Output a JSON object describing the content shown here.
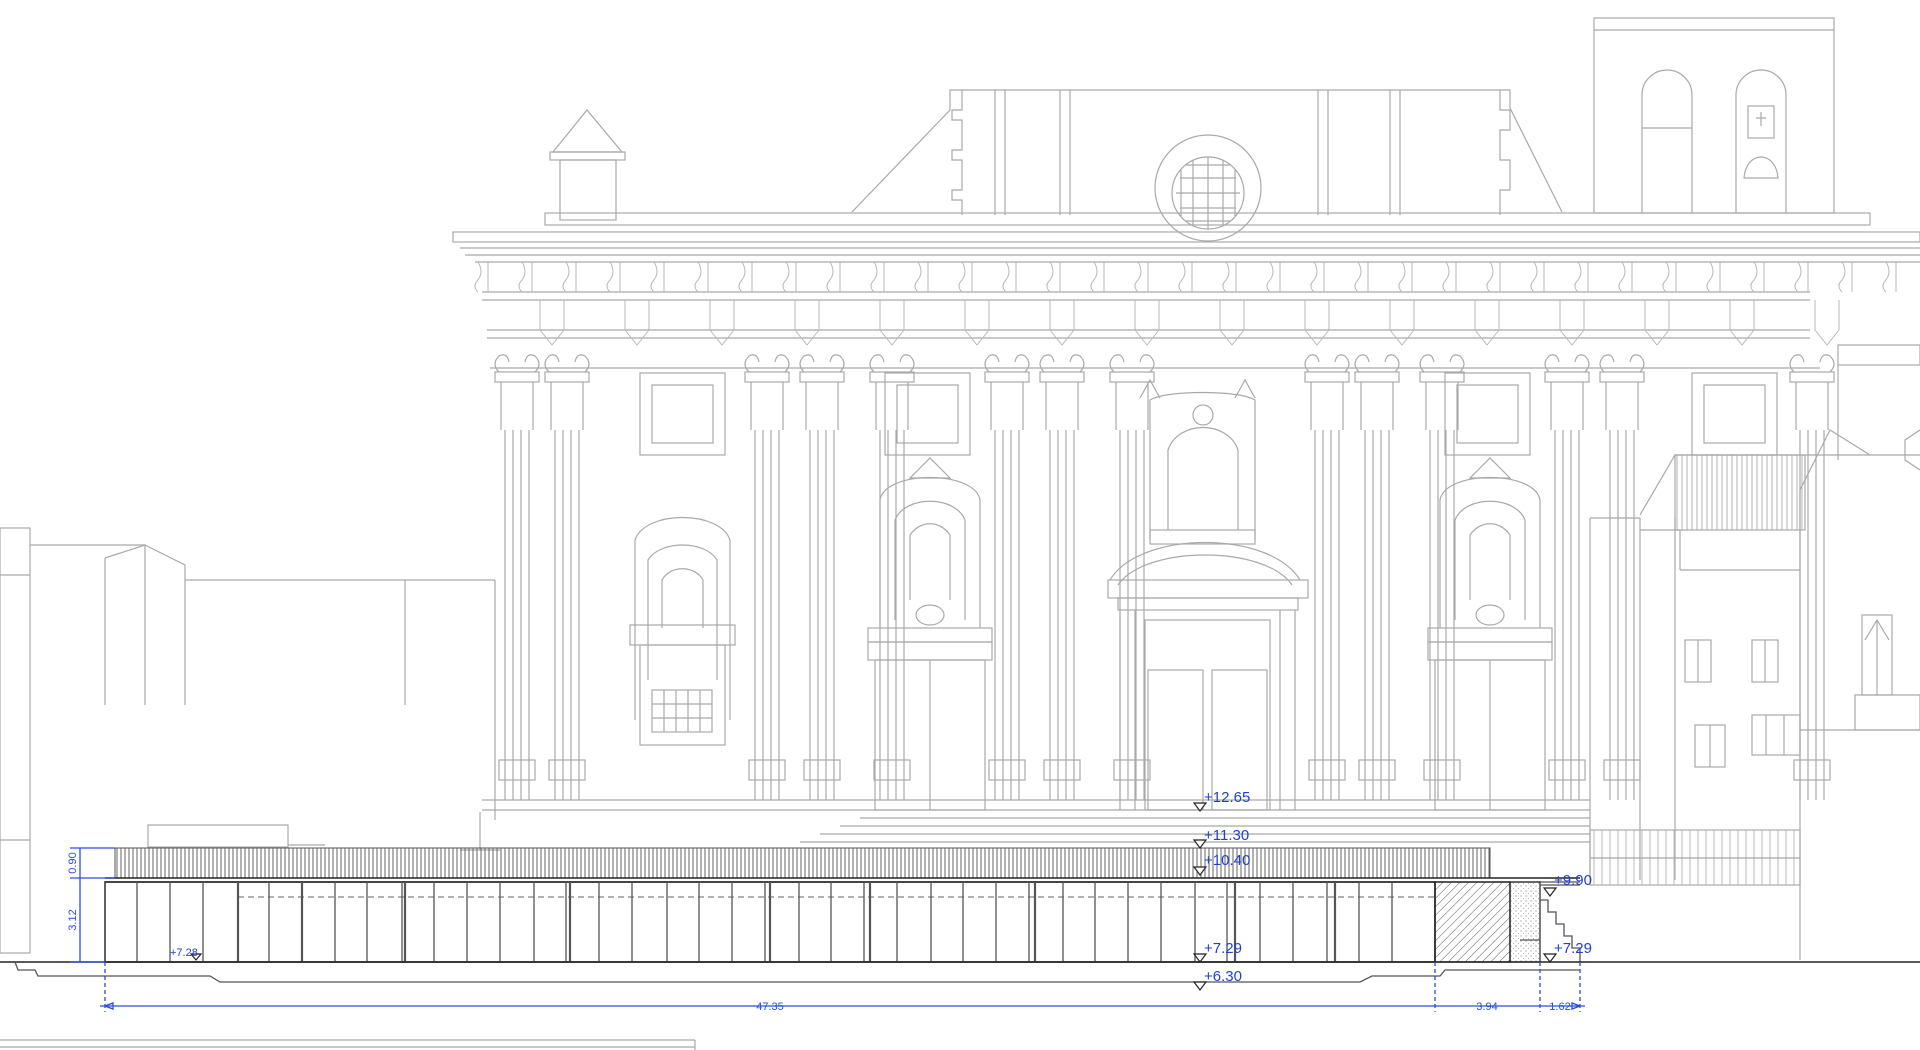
{
  "drawing": {
    "elevations": [
      {
        "id": "e1265",
        "label": "+12.65"
      },
      {
        "id": "e1130",
        "label": "+11.30"
      },
      {
        "id": "e1040",
        "label": "+10.40"
      },
      {
        "id": "e990",
        "label": "+9.90"
      },
      {
        "id": "e729c",
        "label": "+7.29"
      },
      {
        "id": "e729r",
        "label": "+7.29"
      },
      {
        "id": "e728",
        "label": "+7.28"
      },
      {
        "id": "e630",
        "label": "+6.30"
      }
    ],
    "dimensions": {
      "horizontal": [
        "47.35",
        "3.94",
        "1.62"
      ],
      "vertical": [
        "0.90",
        "3.12"
      ]
    },
    "colors": {
      "line_gray": "#a9a9a9",
      "line_dark": "#222222",
      "dimension_blue": "#2a4de0"
    }
  }
}
